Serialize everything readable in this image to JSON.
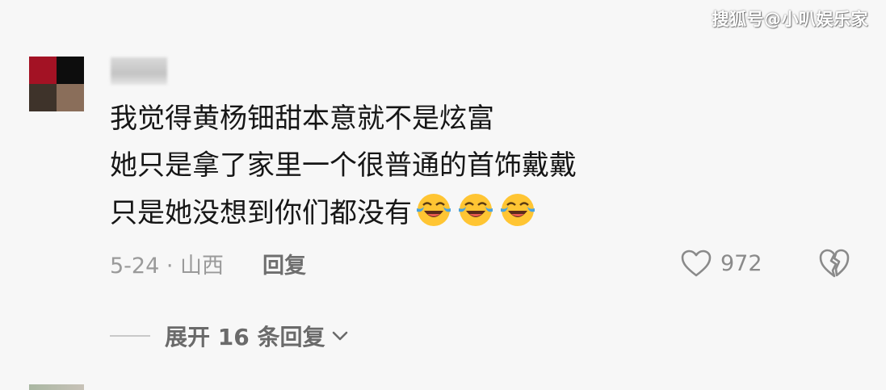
{
  "watermark": "搜狐号@小叭娱乐家",
  "comment": {
    "lines": [
      "我觉得黄杨钿甜本意就不是炫富",
      "她只是拿了家里一个很普通的首饰戴戴",
      "只是她没想到你们都没有"
    ],
    "emoji_icon": "face-with-tears-of-joy"
  },
  "meta": {
    "date_location": "5-24 · 山西",
    "reply_label": "回复"
  },
  "likes": {
    "count": "972",
    "icon": "heart-outline-icon"
  },
  "dislike": {
    "icon": "broken-heart-icon"
  },
  "expand": {
    "label": "展开 16 条回复",
    "icon": "chevron-down-icon"
  },
  "colors": {
    "avatar_tl": "#a31224",
    "avatar_tr": "#0d0d0d",
    "avatar_bl": "#3e332a",
    "avatar_br": "#8a6e5a",
    "emoji_face": "#ffc533",
    "emoji_tears": "#4aa3df"
  }
}
